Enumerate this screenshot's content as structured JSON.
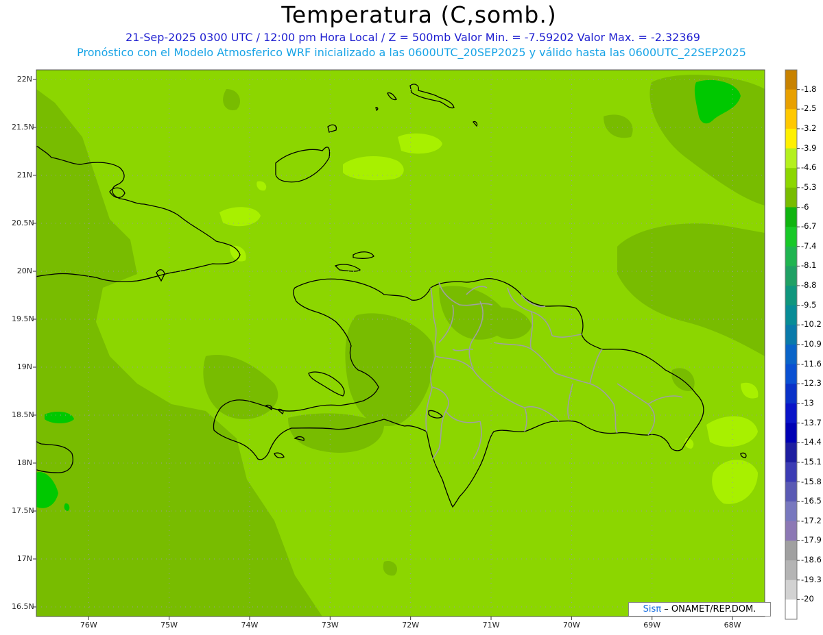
{
  "header": {
    "title": "Temperatura (C,somb.)",
    "subtitle_line1": "21-Sep-2025  0300 UTC / 12:00 pm Hora Local / Z = 500mb  Valor Min. = -7.59202  Valor Max. = -2.32369",
    "subtitle_line2": "Pronóstico con el Modelo Atmosferico WRF inicializado a las 0600UTC_20SEP2025 y válido hasta las  0600UTC_22SEP2025"
  },
  "map": {
    "lat_labels": [
      "22N",
      "21.5N",
      "21N",
      "20.5N",
      "20N",
      "19.5N",
      "19N",
      "18.5N",
      "18N",
      "17.5N",
      "17N",
      "16.5N"
    ],
    "lat_values": [
      22,
      21.5,
      21,
      20.5,
      20,
      19.5,
      19,
      18.5,
      18,
      17.5,
      17,
      16.5
    ],
    "lon_labels": [
      "76W",
      "75W",
      "74W",
      "73W",
      "72W",
      "71W",
      "70W",
      "69W",
      "68W"
    ],
    "lon_values": [
      -76,
      -75,
      -74,
      -73,
      -72,
      -71,
      -70,
      -69,
      -68
    ],
    "lat_range": [
      16.4,
      22.1
    ],
    "lon_range": [
      -76.65,
      -67.6
    ],
    "field_colors": {
      "base": "#8cd600",
      "cooler": "#78bc00",
      "warmer": "#a8f000",
      "coolest": "#00c800"
    }
  },
  "legend": {
    "labels": [
      "-1.8",
      "-2.5",
      "-3.2",
      "-3.9",
      "-4.6",
      "-5.3",
      "-6",
      "-6.7",
      "-7.4",
      "-8.1",
      "-8.8",
      "-9.5",
      "-10.2",
      "-10.9",
      "-11.6",
      "-12.3",
      "-13",
      "-13.7",
      "-14.4",
      "-15.1",
      "-15.8",
      "-16.5",
      "-17.2",
      "-17.9",
      "-18.6",
      "-19.3",
      "-20"
    ],
    "colors": [
      "#c88200",
      "#e8a000",
      "#ffc800",
      "#fff000",
      "#b4f01e",
      "#8cd600",
      "#78bc00",
      "#10b410",
      "#18c828",
      "#20b450",
      "#20a064",
      "#10967d",
      "#088c96",
      "#0a7aaa",
      "#0a64c8",
      "#0a50d2",
      "#0a32c8",
      "#0a14c8",
      "#0000b4",
      "#1e1ea0",
      "#3c3cb4",
      "#5a5ab4",
      "#7878be",
      "#8c78b4",
      "#a0a0a0",
      "#b4b4b4",
      "#d2d2d2",
      "#ffffff"
    ]
  },
  "credit": {
    "sis": "Sisπ",
    "rest": "– ONAMET/REP.DOM."
  }
}
